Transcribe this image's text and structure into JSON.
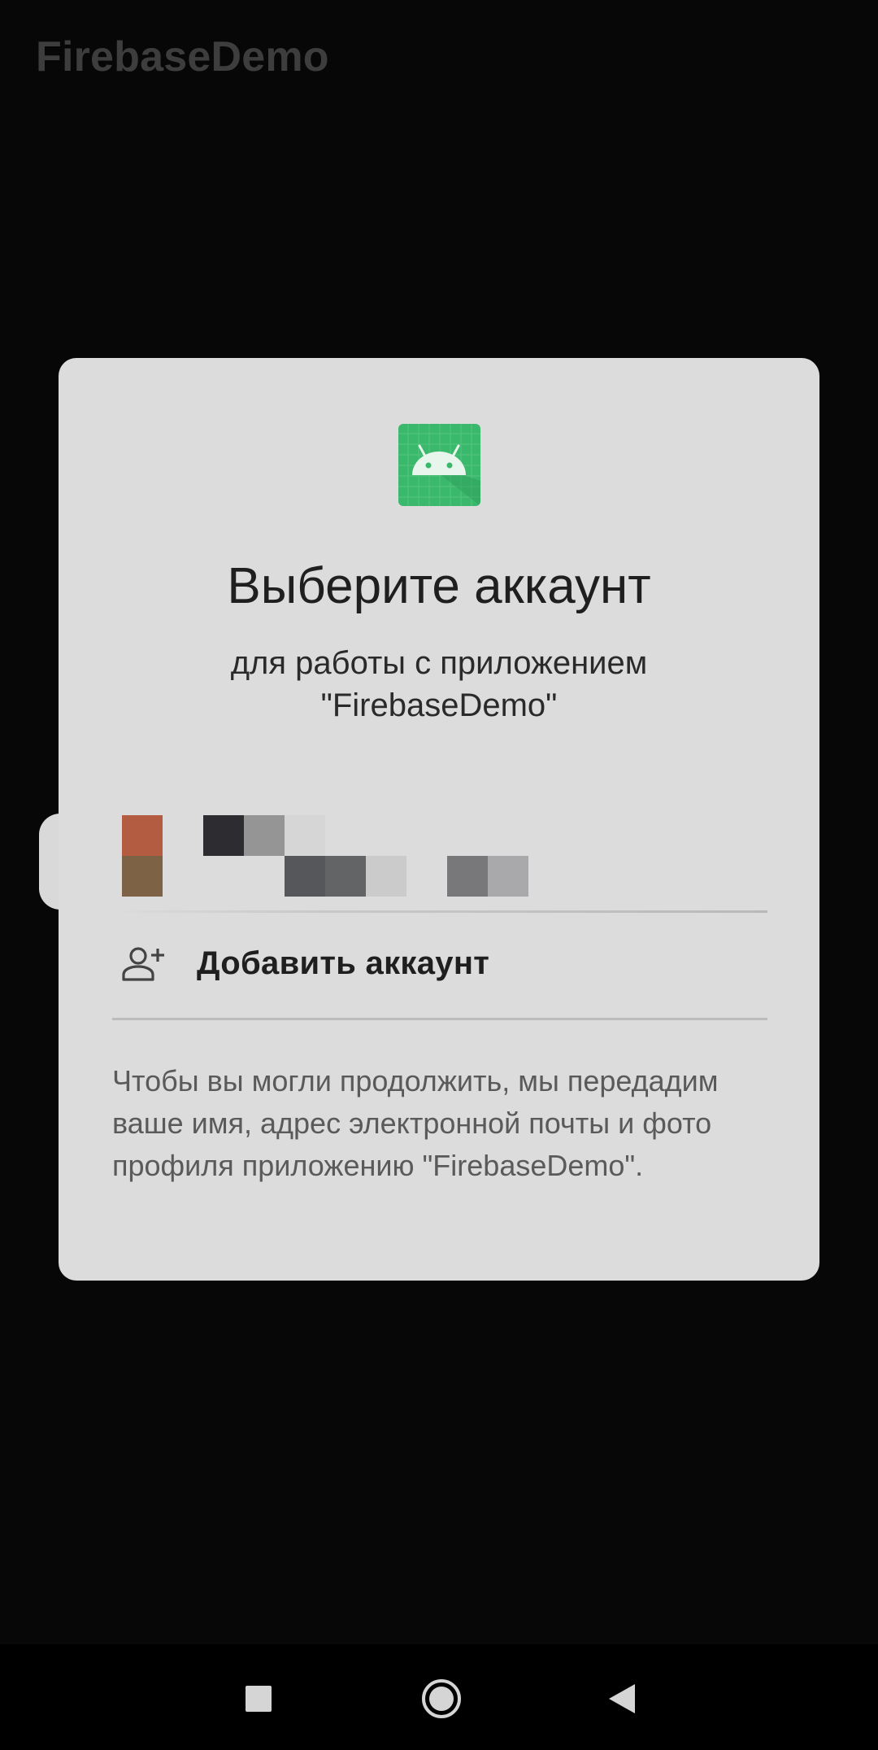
{
  "app": {
    "title": "FirebaseDemo"
  },
  "dialog": {
    "title": "Выберите аккаунт",
    "subtitle_line1": "для работы с приложением",
    "subtitle_line2": "\"FirebaseDemo\"",
    "add_account_label": "Добавить аккаунт",
    "disclaimer": "Чтобы вы могли продолжить, мы передадим ваше имя, адрес электронной почты и фото профиля приложению \"FirebaseDemo\".",
    "account": {
      "name_hidden": true,
      "email_hidden": true
    }
  },
  "icons": {
    "app_icon": "android-robot-icon",
    "add_account_icon": "person-add-icon",
    "nav_recent": "square-icon",
    "nav_home": "circle-icon",
    "nav_back": "triangle-back-icon"
  },
  "colors": {
    "dialog_bg": "#dcdcdc",
    "app_icon_bg": "#3ab86b",
    "screen_bg": "#070707"
  }
}
